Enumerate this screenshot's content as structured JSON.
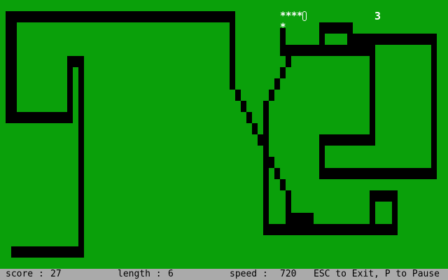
{
  "game": {
    "colors": {
      "field": "#0aa00a",
      "walls": "#000000",
      "snake": "#ffffff",
      "status_bar": "#aaaaaa",
      "status_text": "#000000"
    },
    "snake": {
      "segment_glyph": "*",
      "length": 6
    },
    "food": {
      "value": "3"
    }
  },
  "status": {
    "score_label": "score :",
    "score_value": "27",
    "length_label": "length :",
    "length_value": "6",
    "speed_label": "speed :",
    "speed_value": "720",
    "help_text": "ESC to Exit, P to Pause"
  }
}
